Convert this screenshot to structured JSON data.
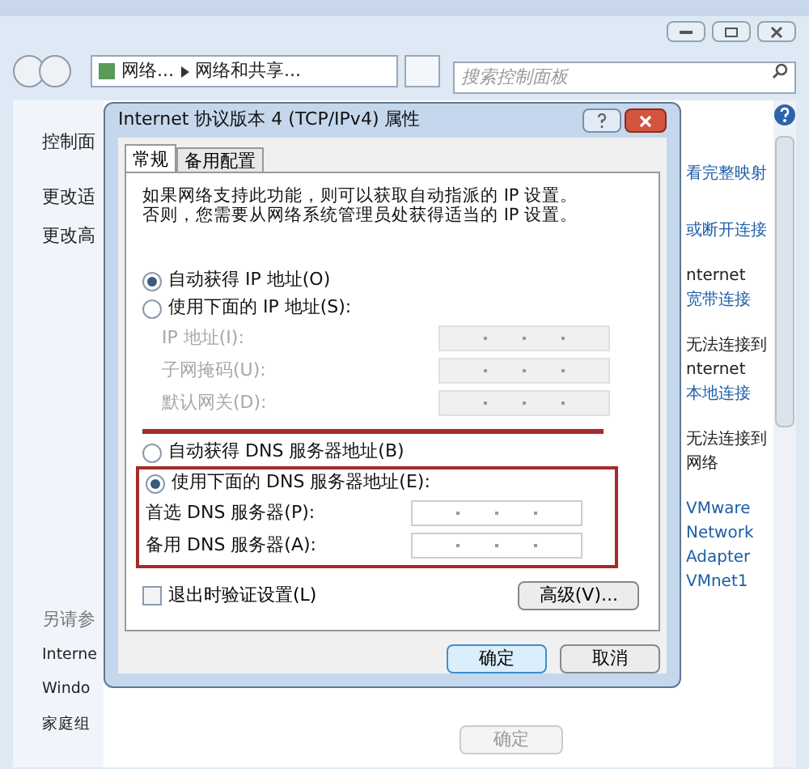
{
  "address_bar": {
    "path": [
      "网络...",
      "网络和共享..."
    ]
  },
  "search": {
    "placeholder": "搜索控制面板"
  },
  "left_panel": {
    "items": [
      "控制面",
      "更改适",
      "更改高"
    ],
    "see_also_heading": "另请参",
    "see_also": [
      "Interne",
      "Windo",
      "家庭组"
    ]
  },
  "right_panel": [
    {
      "text": "看完整映射",
      "kind": "link"
    },
    {
      "text": "或断开连接",
      "kind": "link"
    },
    {
      "text": "nternet",
      "kind": "plain"
    },
    {
      "text": "宽带连接",
      "kind": "link"
    },
    {
      "text": "无法连接到",
      "kind": "plain"
    },
    {
      "text": "nternet",
      "kind": "plain"
    },
    {
      "text": "本地连接",
      "kind": "link"
    },
    {
      "text": "无法连接到",
      "kind": "plain"
    },
    {
      "text": "网络",
      "kind": "plain"
    },
    {
      "text": "VMware",
      "kind": "link"
    },
    {
      "text": "Network",
      "kind": "link"
    },
    {
      "text": "Adapter",
      "kind": "link"
    },
    {
      "text": "VMnet1",
      "kind": "link"
    }
  ],
  "background_buttons": [
    {
      "label": "确定",
      "disabled": true
    }
  ],
  "dialog": {
    "title": "Internet 协议版本 4 (TCP/IPv4) 属性",
    "tabs": [
      {
        "label": "常规",
        "selected": true
      },
      {
        "label": "备用配置",
        "selected": false
      }
    ],
    "description": "如果网络支持此功能，则可以获取自动指派的 IP 设置。否则，您需要从网络系统管理员处获得适当的 IP 设置。",
    "ip_options": [
      {
        "label": "自动获得 IP 地址(O)",
        "selected": true
      },
      {
        "label": "使用下面的 IP 地址(S):",
        "selected": false
      }
    ],
    "ip_fields": [
      {
        "label": "IP 地址(I):",
        "disabled": true
      },
      {
        "label": "子网掩码(U):",
        "disabled": true
      },
      {
        "label": "默认网关(D):",
        "disabled": true
      }
    ],
    "dns_options": [
      {
        "label": "自动获得 DNS 服务器地址(B)",
        "selected": false
      },
      {
        "label": "使用下面的 DNS 服务器地址(E):",
        "selected": true
      }
    ],
    "dns_fields": [
      {
        "label": "首选 DNS 服务器(P):",
        "disabled": false
      },
      {
        "label": "备用 DNS 服务器(A):",
        "disabled": false
      }
    ],
    "validate": {
      "label": "退出时验证设置(L)",
      "checked": false
    },
    "advanced_button": "高级(V)...",
    "buttons": [
      {
        "label": "确定",
        "default": true
      },
      {
        "label": "取消",
        "default": false
      }
    ]
  }
}
